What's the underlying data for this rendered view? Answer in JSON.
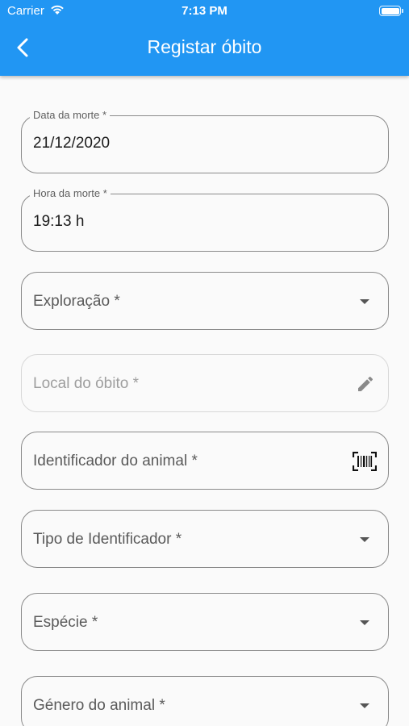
{
  "status_bar": {
    "carrier": "Carrier",
    "time": "7:13 PM"
  },
  "header": {
    "title": "Registar óbito",
    "back_icon": "chevron-left-icon"
  },
  "colors": {
    "accent": "#2196f3",
    "background": "#fafafa"
  },
  "form": {
    "death_date": {
      "label": "Data da morte *",
      "value": "21/12/2020"
    },
    "death_time": {
      "label": "Hora da morte *",
      "value": "19:13 h"
    },
    "exploration": {
      "label": "Exploração *"
    },
    "death_location": {
      "label": "Local do óbito *",
      "icon": "edit-pencil-icon"
    },
    "animal_id": {
      "label": "Identificador do animal *",
      "icon": "barcode-scan-icon"
    },
    "id_type": {
      "label": "Tipo de Identificador *"
    },
    "species": {
      "label": "Espécie *"
    },
    "gender": {
      "label": "Género do animal *"
    }
  }
}
